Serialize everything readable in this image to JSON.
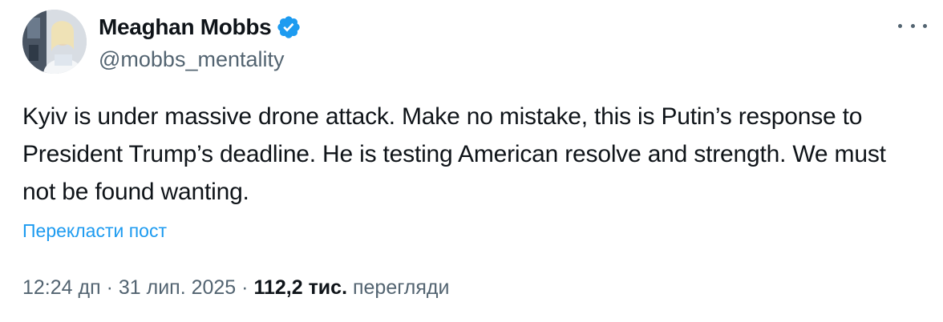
{
  "author": {
    "display_name": "Meaghan Mobbs",
    "handle": "@mobbs_mentality",
    "verified_icon": "verified-badge-icon",
    "avatar_icon": "profile-photo"
  },
  "tweet": {
    "text": "Kyiv is under massive drone attack. Make no mistake, this is Putin’s response to President Trump’s deadline. He is testing American resolve and strength. We must not be found wanting.",
    "translate_label": "Перекласти пост"
  },
  "meta": {
    "time": "12:24 дп",
    "separator": " · ",
    "date": "31 лип. 2025",
    "views_count": "112,2 тис.",
    "views_label": "перегляди"
  },
  "menu": {
    "icon": "more-options-icon"
  },
  "colors": {
    "text": "#0f1419",
    "secondary": "#536471",
    "link": "#1d9bf0",
    "verified": "#1d9bf0"
  }
}
